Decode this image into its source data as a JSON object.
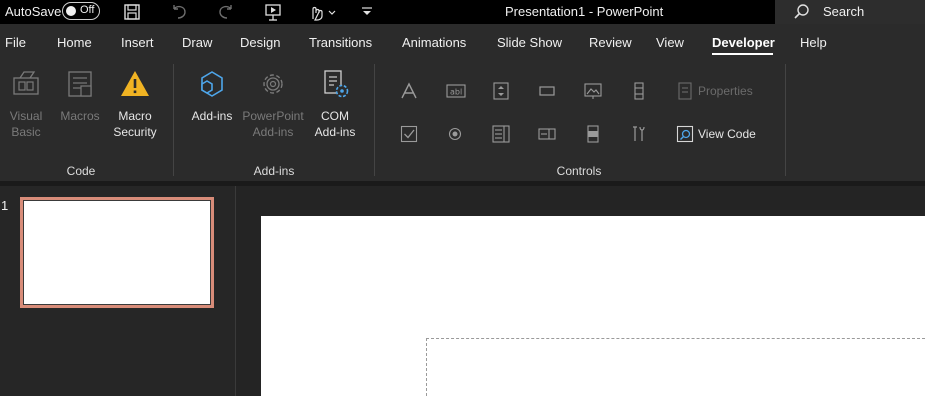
{
  "titlebar": {
    "autosave_label": "AutoSave",
    "autosave_state": "Off",
    "title": "Presentation1  -  PowerPoint",
    "search_label": "Search"
  },
  "tabs": [
    "File",
    "Home",
    "Insert",
    "Draw",
    "Design",
    "Transitions",
    "Animations",
    "Slide Show",
    "Review",
    "View",
    "Developer",
    "Help"
  ],
  "active_tab": "Developer",
  "ribbon": {
    "code": {
      "label": "Code",
      "visual_basic": "Visual Basic",
      "macros": "Macros",
      "macro_security": "Macro Security"
    },
    "addins": {
      "label": "Add-ins",
      "add_ins": "Add-ins",
      "powerpoint_addins": "PowerPoint Add-ins",
      "com_addins": "COM Add-ins"
    },
    "controls": {
      "label": "Controls",
      "properties": "Properties",
      "view_code": "View Code"
    }
  },
  "slides": {
    "number": "1"
  },
  "colors": {
    "accent_thumb_border": "#d88c79",
    "titlebar_bg": "#000000",
    "ribbon_bg": "#2b2b2b",
    "addins_icon": "#4ea6ea",
    "macro_security_icon": "#f0b323"
  }
}
